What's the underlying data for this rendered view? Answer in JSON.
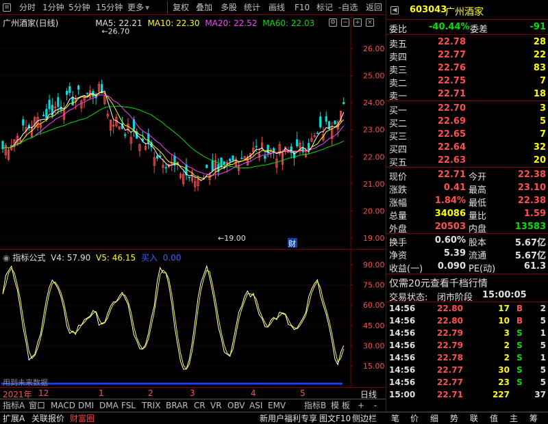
{
  "toolbar": {
    "items": [
      "分时",
      "1分钟",
      "5分钟",
      "15分钟",
      "更多",
      "复权",
      "叠加",
      "多股",
      "统计",
      "画线",
      "F10",
      "标记",
      "-自选",
      "返回"
    ]
  },
  "chart_header": {
    "title": "广州酒家(日线)",
    "ma5": "MA5: 22.21",
    "ma10": "MA10: 22.30",
    "ma20": "MA20: 22.52",
    "ma60": "MA60: 22.03",
    "colors": {
      "ma5": "#ffffff",
      "ma10": "#ffff00",
      "ma20": "#ff40ff",
      "ma60": "#00e000",
      "up": "#ff5050",
      "down": "#00e0e0"
    }
  },
  "price_axis": [
    "26.00",
    "25.00",
    "24.00",
    "23.00",
    "22.00",
    "21.00",
    "20.00",
    "19.00"
  ],
  "price_annotations": {
    "high": "26.70",
    "low": "19.00",
    "cai": "财"
  },
  "indicator": {
    "name": "指标公式",
    "v4": "V4: 57.90",
    "v5": "V5: 46.15",
    "buy_label": "买入",
    "buy_value": "0.00",
    "axis": [
      "90.00",
      "75.00",
      "60.00",
      "45.00",
      "30.00",
      "15.00"
    ],
    "note": "用到未来数据"
  },
  "date_axis": {
    "labels": [
      "2021年",
      "12",
      "1",
      "2",
      "3",
      "4",
      "5"
    ],
    "right": "日线"
  },
  "tabs": [
    "指标A",
    "窗口",
    "MACD",
    "DMI",
    "DMA",
    "FSL",
    "TRIX",
    "BRAR",
    "CR",
    "VR",
    "OBV",
    "ASI",
    "EMV",
    "指标B",
    "模 板",
    "+",
    "-"
  ],
  "status_left": [
    "扩展A",
    "关联报价",
    "财富圈"
  ],
  "status_mid": [
    "新用户福利专享",
    "图文F10",
    "侧边栏"
  ],
  "status_right": [
    "笔",
    "价",
    "细",
    "势",
    "联",
    "值",
    "主",
    "筹"
  ],
  "quote": {
    "code": "603043",
    "name": "广州酒家",
    "weibi_label": "委比",
    "weibi": "-40.44%",
    "weicha_label": "委差",
    "weicha": "-91",
    "sells": [
      {
        "label": "卖五",
        "price": "22.78",
        "vol": "28"
      },
      {
        "label": "卖四",
        "price": "22.77",
        "vol": "22"
      },
      {
        "label": "卖三",
        "price": "22.76",
        "vol": "83"
      },
      {
        "label": "卖二",
        "price": "22.75",
        "vol": "7"
      },
      {
        "label": "卖一",
        "price": "22.71",
        "vol": "18"
      }
    ],
    "buys": [
      {
        "label": "买一",
        "price": "22.70",
        "vol": "3"
      },
      {
        "label": "买二",
        "price": "22.69",
        "vol": "5"
      },
      {
        "label": "买三",
        "price": "22.65",
        "vol": "7"
      },
      {
        "label": "买四",
        "price": "22.64",
        "vol": "32"
      },
      {
        "label": "买五",
        "price": "22.63",
        "vol": "20"
      }
    ],
    "stats": [
      {
        "l1": "现价",
        "v1": "22.71",
        "l2": "今开",
        "v2": "22.38"
      },
      {
        "l1": "涨跌",
        "v1": "0.41",
        "l2": "最高",
        "v2": "23.10"
      },
      {
        "l1": "涨幅",
        "v1": "1.84%",
        "l2": "最低",
        "v2": "22.38"
      },
      {
        "l1": "总量",
        "v1": "34086",
        "l2": "量比",
        "v2": "1.59"
      },
      {
        "l1": "外盘",
        "v1": "20503",
        "l2": "内盘",
        "v2": "13583"
      }
    ],
    "fin": [
      {
        "l1": "换手",
        "v1": "0.60%",
        "l2": "股本",
        "v2": "5.67亿"
      },
      {
        "l1": "净资",
        "v1": "5.39",
        "l2": "流通",
        "v2": "5.67亿"
      },
      {
        "l1": "收益(一)",
        "v1": "0.090",
        "l2": "PE(动)",
        "v2": "61.3"
      }
    ],
    "promo": "仅需20元查看千档行情",
    "trade_status_label": "交易状态:",
    "trade_status": "闭市阶段",
    "trade_time": "15:00:05",
    "ticks": [
      {
        "t": "14:56",
        "p": "22.80",
        "v": "17",
        "bs": "B",
        "n": "2"
      },
      {
        "t": "14:56",
        "p": "22.80",
        "v": "10",
        "bs": "B",
        "n": "5"
      },
      {
        "t": "14:56",
        "p": "22.79",
        "v": "3",
        "bs": "S",
        "n": "1"
      },
      {
        "t": "14:56",
        "p": "22.79",
        "v": "2",
        "bs": "S",
        "n": "5"
      },
      {
        "t": "14:56",
        "p": "22.78",
        "v": "2",
        "bs": "S",
        "n": "1"
      },
      {
        "t": "14:56",
        "p": "22.77",
        "v": "30",
        "bs": "S",
        "n": "5"
      },
      {
        "t": "14:56",
        "p": "22.77",
        "v": "23",
        "bs": "S",
        "n": "5"
      },
      {
        "t": "15:00",
        "p": "22.71",
        "v": "227",
        "bs": "",
        "n": "37"
      }
    ]
  }
}
